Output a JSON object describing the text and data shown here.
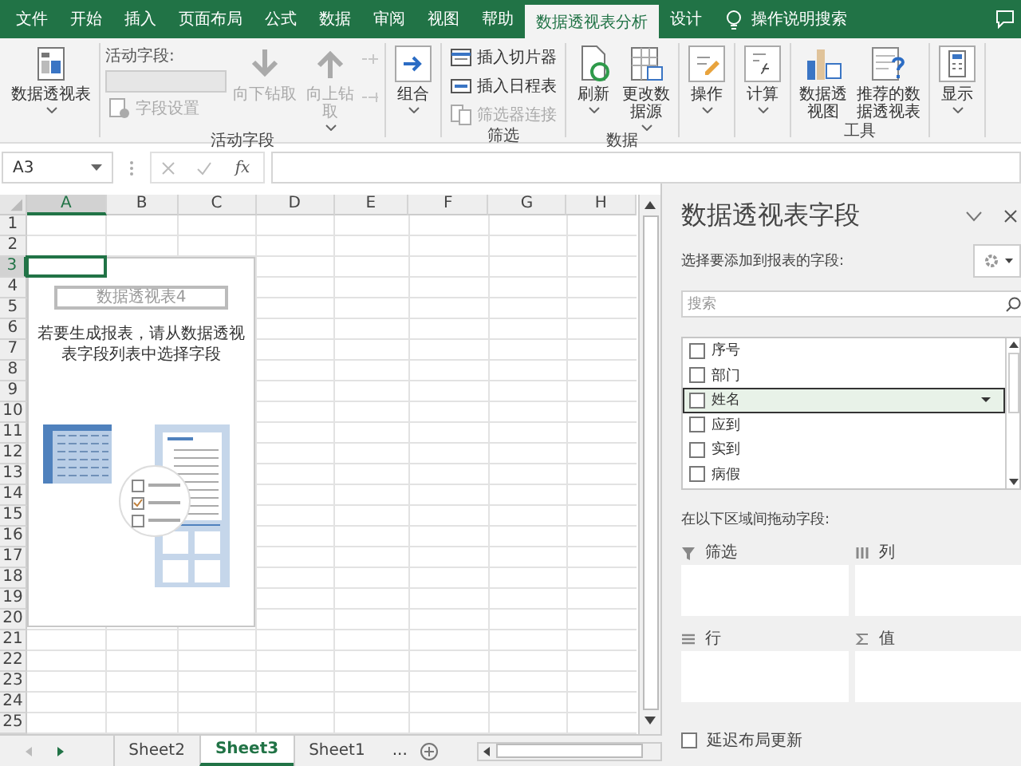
{
  "tabs": [
    {
      "label": "文件",
      "selected": false
    },
    {
      "label": "开始",
      "selected": false
    },
    {
      "label": "插入",
      "selected": false
    },
    {
      "label": "页面布局",
      "selected": false
    },
    {
      "label": "公式",
      "selected": false
    },
    {
      "label": "数据",
      "selected": false
    },
    {
      "label": "审阅",
      "selected": false
    },
    {
      "label": "视图",
      "selected": false
    },
    {
      "label": "帮助",
      "selected": false
    },
    {
      "label": "数据透视表分析",
      "selected": true
    },
    {
      "label": "设计",
      "selected": false
    }
  ],
  "tell_me": {
    "label": "操作说明搜索"
  },
  "ribbon": {
    "groups": [
      {
        "items": [
          {
            "kind": "large",
            "label": "数据透视表",
            "caret": true,
            "disabled": false
          }
        ]
      },
      {
        "label": "活动字段",
        "items": [
          {
            "kind": "field",
            "label": "活动字段:",
            "disabled": true
          },
          {
            "kind": "small",
            "label": "字段设置",
            "disabled": true
          },
          {
            "kind": "large",
            "label": "向下钻取",
            "caret": false,
            "disabled": true
          },
          {
            "kind": "large",
            "label": "向上钻取",
            "caret": true,
            "disabled": true
          },
          {
            "kind": "tool",
            "disabled": true
          },
          {
            "kind": "tool",
            "disabled": true
          }
        ]
      },
      {
        "items": [
          {
            "kind": "large",
            "label": "组合",
            "caret": true,
            "disabled": false
          }
        ]
      },
      {
        "label": "筛选",
        "items": [
          {
            "kind": "small",
            "label": "插入切片器",
            "disabled": false
          },
          {
            "kind": "small",
            "label": "插入日程表",
            "disabled": false
          },
          {
            "kind": "small",
            "label": "筛选器连接",
            "disabled": true
          }
        ]
      },
      {
        "label": "数据",
        "items": [
          {
            "kind": "large",
            "label": "刷新",
            "caret": true,
            "disabled": false
          },
          {
            "kind": "large",
            "label": "更改数据源",
            "caret": true,
            "disabled": false
          }
        ]
      },
      {
        "items": [
          {
            "kind": "large",
            "label": "操作",
            "caret": true,
            "disabled": false
          }
        ]
      },
      {
        "items": [
          {
            "kind": "large",
            "label": "计算",
            "caret": true,
            "disabled": false
          }
        ]
      },
      {
        "label": "工具",
        "items": [
          {
            "kind": "large",
            "label": "数据透视图",
            "caret": false,
            "disabled": false
          },
          {
            "kind": "large",
            "label": "推荐的数据透视表",
            "caret": false,
            "disabled": false
          }
        ]
      },
      {
        "items": [
          {
            "kind": "large",
            "label": "显示",
            "caret": true,
            "disabled": false
          }
        ]
      }
    ]
  },
  "name_box": {
    "value": "A3"
  },
  "formula_bar": {
    "function_label": "fx"
  },
  "grid": {
    "columns": [
      {
        "label": "A",
        "selected": true
      },
      {
        "label": "B",
        "selected": false
      },
      {
        "label": "C",
        "selected": false
      },
      {
        "label": "D",
        "selected": false
      },
      {
        "label": "E",
        "selected": false
      },
      {
        "label": "F",
        "selected": false
      },
      {
        "label": "G",
        "selected": false
      },
      {
        "label": "H",
        "selected": false
      }
    ],
    "rows": [
      {
        "label": "1",
        "selected": false
      },
      {
        "label": "2",
        "selected": false
      },
      {
        "label": "3",
        "selected": true
      },
      {
        "label": "4",
        "selected": false
      },
      {
        "label": "5",
        "selected": false
      },
      {
        "label": "6",
        "selected": false
      },
      {
        "label": "7",
        "selected": false
      },
      {
        "label": "8",
        "selected": false
      },
      {
        "label": "9",
        "selected": false
      },
      {
        "label": "10",
        "selected": false
      },
      {
        "label": "11",
        "selected": false
      },
      {
        "label": "12",
        "selected": false
      },
      {
        "label": "13",
        "selected": false
      },
      {
        "label": "14",
        "selected": false
      },
      {
        "label": "15",
        "selected": false
      },
      {
        "label": "16",
        "selected": false
      },
      {
        "label": "17",
        "selected": false
      },
      {
        "label": "18",
        "selected": false
      },
      {
        "label": "19",
        "selected": false
      },
      {
        "label": "20",
        "selected": false
      },
      {
        "label": "21",
        "selected": false
      },
      {
        "label": "22",
        "selected": false
      },
      {
        "label": "23",
        "selected": false
      },
      {
        "label": "24",
        "selected": false
      },
      {
        "label": "25",
        "selected": false
      }
    ]
  },
  "pivot_placeholder": {
    "title": "数据透视表4",
    "instruction": "若要生成报表，请从数据透视表字段列表中选择字段"
  },
  "sheet_tabs": [
    {
      "label": "Sheet2",
      "selected": false
    },
    {
      "label": "Sheet3",
      "selected": true
    },
    {
      "label": "Sheet1",
      "selected": false
    }
  ],
  "more_sheets": "...",
  "field_pane": {
    "title": "数据透视表字段",
    "prompt": "选择要添加到报表的字段:",
    "search_placeholder": "搜索",
    "fields": [
      {
        "label": "序号",
        "checked": false,
        "selected": false
      },
      {
        "label": "部门",
        "checked": false,
        "selected": false
      },
      {
        "label": "姓名",
        "checked": false,
        "selected": true
      },
      {
        "label": "应到",
        "checked": false,
        "selected": false
      },
      {
        "label": "实到",
        "checked": false,
        "selected": false
      },
      {
        "label": "病假",
        "checked": false,
        "selected": false
      }
    ],
    "areas_prompt": "在以下区域间拖动字段:",
    "areas": [
      {
        "kind": "filters",
        "label": "筛选"
      },
      {
        "kind": "columns",
        "label": "列"
      },
      {
        "kind": "rows",
        "label": "行"
      },
      {
        "kind": "values",
        "label": "值"
      }
    ],
    "defer": {
      "label": "延迟布局更新",
      "checked": false
    }
  }
}
